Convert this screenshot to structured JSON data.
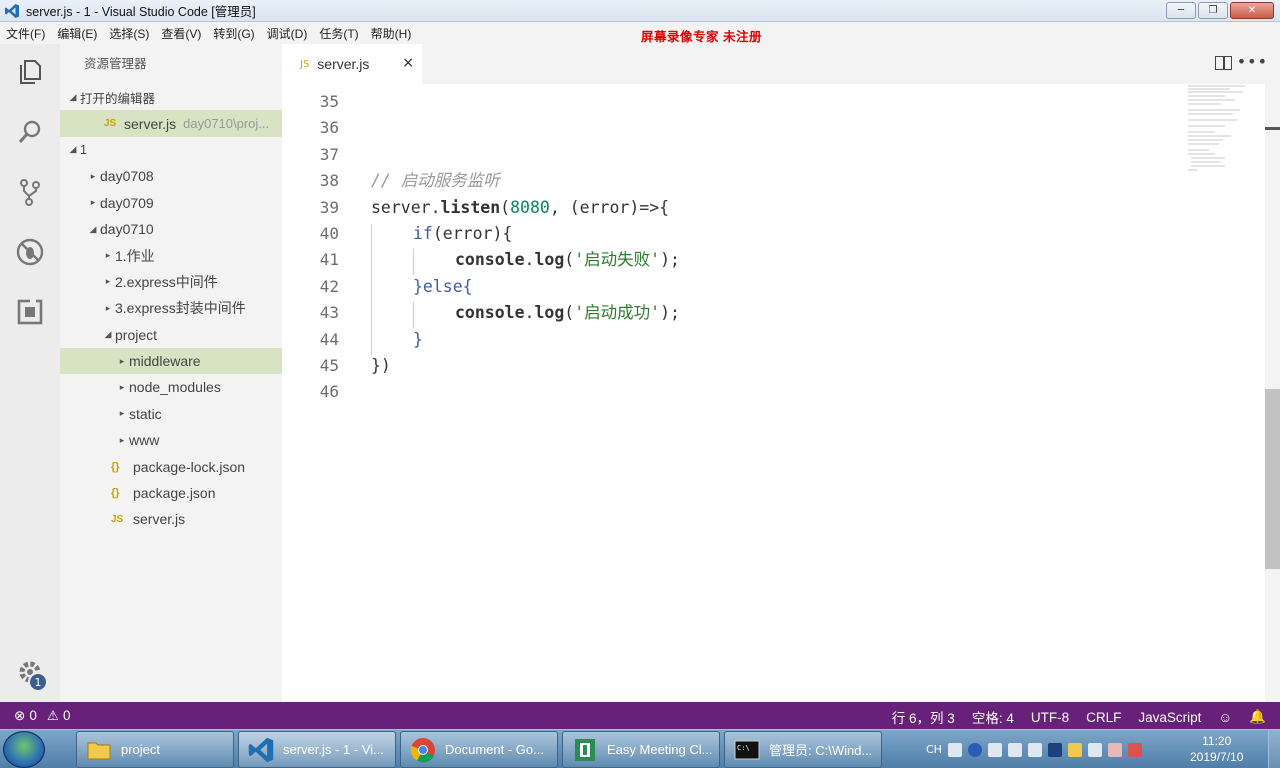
{
  "window": {
    "title": "server.js - 1 - Visual Studio Code [管理员]"
  },
  "menu": [
    "文件(F)",
    "编辑(E)",
    "选择(S)",
    "查看(V)",
    "转到(G)",
    "调试(D)",
    "任务(T)",
    "帮助(H)"
  ],
  "watermark": "屏幕录像专家  未注册",
  "sidebar": {
    "title": "资源管理器",
    "open_editors_header": "打开的编辑器",
    "open_editor": {
      "name": "server.js",
      "path": "day0710\\proj..."
    },
    "workspace_header": "1",
    "tree": [
      {
        "label": "day0708",
        "type": "folder",
        "depth": 1
      },
      {
        "label": "day0709",
        "type": "folder",
        "depth": 1
      },
      {
        "label": "day0710",
        "type": "folder-open",
        "depth": 1
      },
      {
        "label": "1.作业",
        "type": "folder",
        "depth": 2
      },
      {
        "label": "2.express中间件",
        "type": "folder",
        "depth": 2
      },
      {
        "label": "3.express封装中间件",
        "type": "folder",
        "depth": 2
      },
      {
        "label": "project",
        "type": "folder-open",
        "depth": 2
      },
      {
        "label": "middleware",
        "type": "folder",
        "depth": 3,
        "selected": true
      },
      {
        "label": "node_modules",
        "type": "folder",
        "depth": 3
      },
      {
        "label": "static",
        "type": "folder",
        "depth": 3
      },
      {
        "label": "www",
        "type": "folder",
        "depth": 3
      },
      {
        "label": "package-lock.json",
        "type": "json",
        "depth": 3
      },
      {
        "label": "package.json",
        "type": "json",
        "depth": 3
      },
      {
        "label": "server.js",
        "type": "js",
        "depth": 3
      }
    ]
  },
  "activity_badge": "1",
  "editor": {
    "tab": {
      "icon": "JS",
      "label": "server.js",
      "close": "×"
    },
    "lines": [
      {
        "n": "35",
        "indent": 0,
        "tokens": []
      },
      {
        "n": "36",
        "indent": 0,
        "tokens": []
      },
      {
        "n": "37",
        "indent": 0,
        "tokens": []
      },
      {
        "n": "38",
        "indent": 0,
        "tokens": [
          {
            "t": "// 启动服务监听",
            "c": "cm"
          }
        ]
      },
      {
        "n": "39",
        "indent": 0,
        "tokens": [
          {
            "t": "server",
            "c": ""
          },
          {
            "t": ".",
            "c": ""
          },
          {
            "t": "listen",
            "c": "fn"
          },
          {
            "t": "(",
            "c": ""
          },
          {
            "t": "8080",
            "c": "num"
          },
          {
            "t": ", (",
            "c": ""
          },
          {
            "t": "error",
            "c": ""
          },
          {
            "t": ")=>{",
            "c": ""
          }
        ]
      },
      {
        "n": "40",
        "indent": 1,
        "tokens": [
          {
            "t": "if",
            "c": "kw"
          },
          {
            "t": "(error){",
            "c": ""
          }
        ]
      },
      {
        "n": "41",
        "indent": 2,
        "tokens": [
          {
            "t": "console",
            "c": "fn"
          },
          {
            "t": ".",
            "c": ""
          },
          {
            "t": "log",
            "c": "fn"
          },
          {
            "t": "(",
            "c": ""
          },
          {
            "t": "'启动失败'",
            "c": "str"
          },
          {
            "t": ");",
            "c": ""
          }
        ]
      },
      {
        "n": "42",
        "indent": 1,
        "tokens": [
          {
            "t": "}else{",
            "c": "kw"
          }
        ]
      },
      {
        "n": "43",
        "indent": 2,
        "tokens": [
          {
            "t": "console",
            "c": "fn"
          },
          {
            "t": ".",
            "c": ""
          },
          {
            "t": "log",
            "c": "fn"
          },
          {
            "t": "(",
            "c": ""
          },
          {
            "t": "'启动成功'",
            "c": "str"
          },
          {
            "t": ");",
            "c": ""
          }
        ]
      },
      {
        "n": "44",
        "indent": 1,
        "tokens": [
          {
            "t": "}",
            "c": "kw"
          }
        ]
      },
      {
        "n": "45",
        "indent": 0,
        "tokens": [
          {
            "t": "})",
            "c": ""
          }
        ]
      },
      {
        "n": "46",
        "indent": 0,
        "tokens": []
      }
    ]
  },
  "status": {
    "errors": "0",
    "warnings": "0",
    "position": "行 6，列 3",
    "spaces": "空格: 4",
    "encoding": "UTF-8",
    "eol": "CRLF",
    "language": "JavaScript"
  },
  "taskbar": {
    "items": [
      "project",
      "server.js - 1 - Vi...",
      "Document - Go...",
      "Easy Meeting Cl...",
      "管理员: C:\\Wind..."
    ],
    "lang": "CH",
    "time": "11:20",
    "date": "2019/7/10"
  },
  "colors": {
    "status_bar": "#68217a",
    "selection": "#d7e3c3"
  }
}
